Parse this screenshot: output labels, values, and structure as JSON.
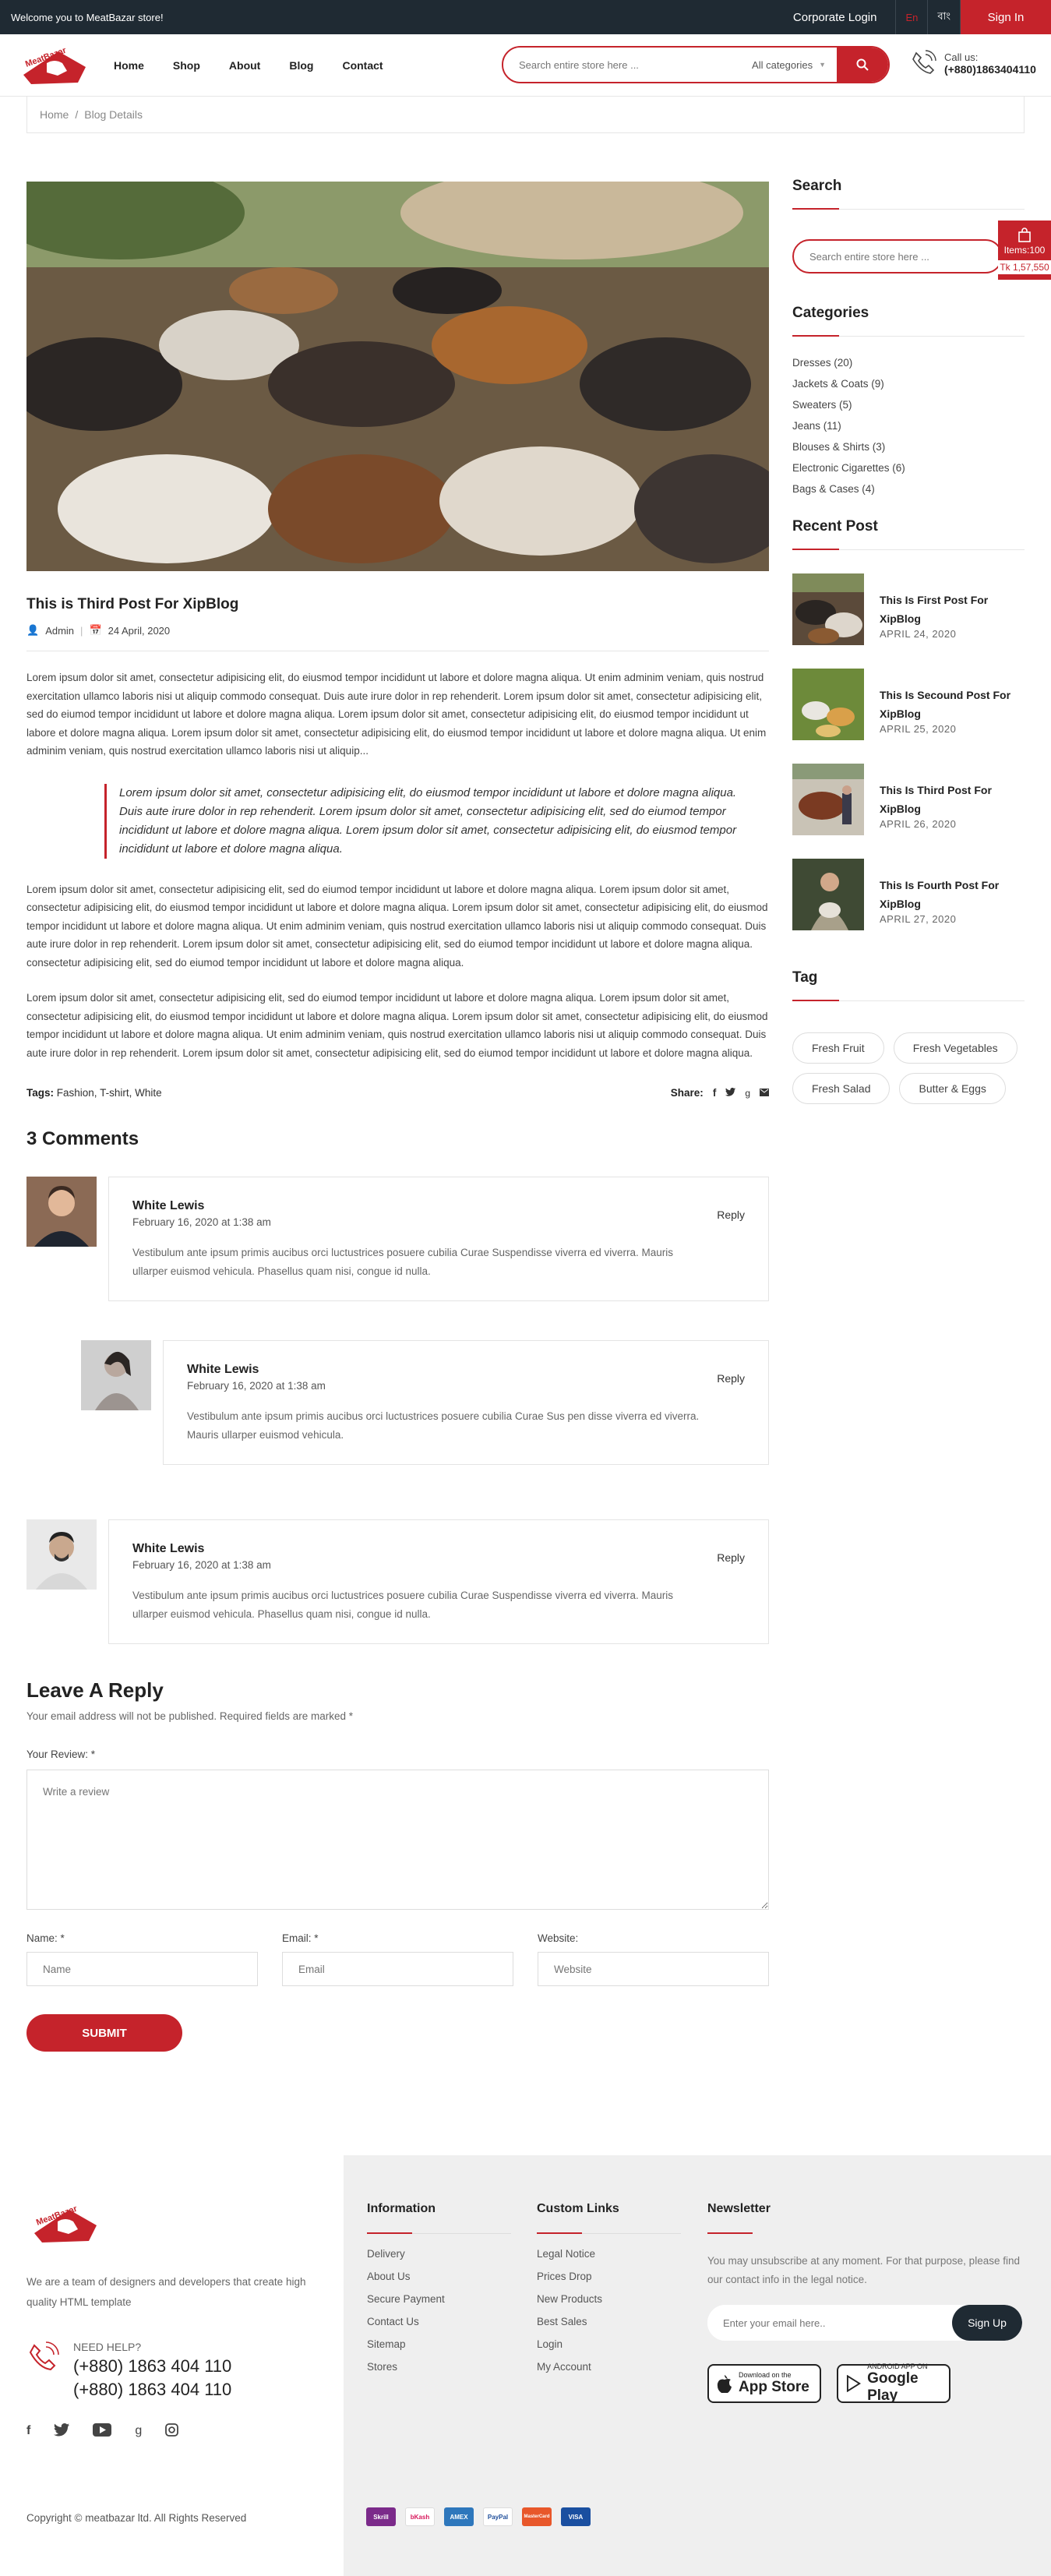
{
  "topbar": {
    "welcome": "Welcome you to MeatBazar store!",
    "corporate": "Corporate Login",
    "lang_en": "En",
    "lang_bn": "বাং",
    "signin": "Sign In"
  },
  "header": {
    "nav": [
      "Home",
      "Shop",
      "About",
      "Blog",
      "Contact"
    ],
    "search_placeholder": "Search entire store here ...",
    "category": "All categories",
    "call_label": "Call us:",
    "call_number": "(+880)1863404110"
  },
  "breadcrumb": {
    "home": "Home",
    "sep": "/",
    "current": "Blog Details"
  },
  "post": {
    "title": "This is Third Post For XipBlog",
    "author": "Admin",
    "date": "24 April, 2020",
    "para1": "Lorem ipsum dolor sit amet, consectetur adipisicing elit, do eiusmod tempor incididunt ut labore et dolore magna aliqua. Ut enim adminim veniam, quis nostrud exercitation ullamco laboris nisi ut aliquip commodo consequat. Duis aute irure dolor in rep rehenderit. Lorem ipsum dolor sit amet, consectetur adipisicing elit, sed do eiumod tempor incididunt ut labore et dolore magna aliqua. Lorem ipsum dolor sit amet, consectetur adipisicing elit, do eiusmod tempor incididunt ut labore et dolore magna aliqua. Lorem ipsum dolor sit amet, consectetur adipisicing elit, do eiusmod tempor incididunt ut labore et dolore magna aliqua. Ut enim adminim veniam, quis nostrud exercitation ullamco laboris nisi ut aliquip...",
    "quote": "Lorem ipsum dolor sit amet, consectetur adipisicing elit, do eiusmod tempor incididunt ut labore et dolore magna aliqua. Duis aute irure dolor in rep rehenderit. Lorem ipsum dolor sit amet, consectetur adipisicing elit, sed do eiumod tempor incididunt ut labore et dolore magna aliqua. Lorem ipsum dolor sit amet, consectetur adipisicing elit, do eiusmod tempor incididunt ut labore et dolore magna aliqua.",
    "para2": "Lorem ipsum dolor sit amet, consectetur adipisicing elit, sed do eiumod tempor incididunt ut labore et dolore magna aliqua. Lorem ipsum dolor sit amet, consectetur adipisicing elit, do eiusmod tempor incididunt ut labore et dolore magna aliqua. Lorem ipsum dolor sit amet, consectetur adipisicing elit, do eiusmod tempor incididunt ut labore et dolore magna aliqua. Ut enim adminim veniam, quis nostrud exercitation ullamco laboris nisi ut aliquip commodo consequat. Duis aute irure dolor in rep rehenderit. Lorem ipsum dolor sit amet, consectetur adipisicing elit, sed do eiumod tempor incididunt ut labore et dolore magna aliqua. consectetur adipisicing elit, sed do eiumod tempor incididunt ut labore et dolore magna aliqua.",
    "para3": "Lorem ipsum dolor sit amet, consectetur adipisicing elit, sed do eiumod tempor incididunt ut labore et dolore magna aliqua. Lorem ipsum dolor sit amet, consectetur adipisicing elit, do eiusmod tempor incididunt ut labore et dolore magna aliqua. Lorem ipsum dolor sit amet, consectetur adipisicing elit, do eiusmod tempor incididunt ut labore et dolore magna aliqua. Ut enim adminim veniam, quis nostrud exercitation ullamco laboris nisi ut aliquip commodo consequat. Duis aute irure dolor in rep rehenderit. Lorem ipsum dolor sit amet, consectetur adipisicing elit, sed do eiumod tempor incididunt ut labore et dolore magna aliqua.",
    "tags_label": "Tags:",
    "tags": [
      "Fashion,",
      "T-shirt,",
      "White"
    ],
    "share_label": "Share:"
  },
  "comments": {
    "title": "3 Comments",
    "reply": "Reply",
    "items": [
      {
        "name": "White Lewis",
        "date": "February 16, 2020 at 1:38 am",
        "text": "Vestibulum ante ipsum primis aucibus orci luctustrices posuere cubilia Curae Suspendisse viverra ed viverra. Mauris ullarper euismod vehicula. Phasellus quam nisi, congue id nulla."
      },
      {
        "name": "White Lewis",
        "date": "February 16, 2020 at 1:38 am",
        "text": "Vestibulum ante ipsum primis aucibus orci luctustrices posuere cubilia Curae Sus pen disse viverra ed viverra. Mauris ullarper euismod vehicula."
      },
      {
        "name": "White Lewis",
        "date": "February 16, 2020 at 1:38 am",
        "text": "Vestibulum ante ipsum primis aucibus orci luctustrices posuere cubilia Curae Suspendisse viverra ed viverra. Mauris ullarper euismod vehicula. Phasellus quam nisi, congue id nulla."
      }
    ]
  },
  "form": {
    "title": "Leave A Reply",
    "note": "Your email address will not be published. Required fields are marked *",
    "review_label": "Your Review: *",
    "review_placeholder": "Write a review",
    "name_label": "Name: *",
    "name_placeholder": "Name",
    "email_label": "Email: *",
    "email_placeholder": "Email",
    "website_label": "Website:",
    "website_placeholder": "Website",
    "submit": "SUBMIT"
  },
  "sidebar": {
    "search_title": "Search",
    "search_placeholder": "Search entire store here ...",
    "categories_title": "Categories",
    "categories": [
      "Dresses (20)",
      "Jackets & Coats (9)",
      "Sweaters (5)",
      "Jeans (11)",
      "Blouses & Shirts (3)",
      "Electronic Cigarettes (6)",
      "Bags & Cases (4)"
    ],
    "recent_title": "Recent Post",
    "recent": [
      {
        "title": "This Is First Post For XipBlog",
        "date": "APRIL 24, 2020"
      },
      {
        "title": "This Is Secound Post For XipBlog",
        "date": "APRIL 25, 2020"
      },
      {
        "title": "This Is Third Post For XipBlog",
        "date": "APRIL 26, 2020"
      },
      {
        "title": "This Is Fourth Post For XipBlog",
        "date": "APRIL 27, 2020"
      }
    ],
    "tag_title": "Tag",
    "tags": [
      "Fresh Fruit",
      "Fresh Vegetables",
      "Fresh Salad",
      "Butter & Eggs"
    ]
  },
  "cart": {
    "items": "Items:100",
    "amount": "Tk 1,57,550"
  },
  "footer": {
    "about": "We are a team of designers and developers that create high quality HTML template",
    "need_help": "NEED HELP?",
    "phone1": "(+880) 1863 404 110",
    "phone2": "(+880) 1863 404 110",
    "copyright": "Copyright © meatbazar ltd. All Rights Reserved",
    "info_title": "Information",
    "info": [
      "Delivery",
      "About Us",
      "Secure Payment",
      "Contact Us",
      "Sitemap",
      "Stores"
    ],
    "links_title": "Custom Links",
    "links": [
      "Legal Notice",
      "Prices Drop",
      "New Products",
      "Best Sales",
      "Login",
      "My Account"
    ],
    "news_title": "Newsletter",
    "news_text": "You may unsubscribe at any moment. For that purpose, please find our contact info in the legal notice.",
    "news_placeholder": "Enter your email here..",
    "news_button": "Sign Up",
    "appstore_small": "Download on the",
    "appstore_big": "App Store",
    "play_small": "ANDROID APP ON",
    "play_big": "Google Play",
    "payments": [
      "Skrill",
      "bKash",
      "AMEX",
      "PayPal",
      "MasterCard",
      "VISA"
    ]
  },
  "colors": {
    "accent": "#c5232b",
    "dark": "#1f2a33"
  }
}
